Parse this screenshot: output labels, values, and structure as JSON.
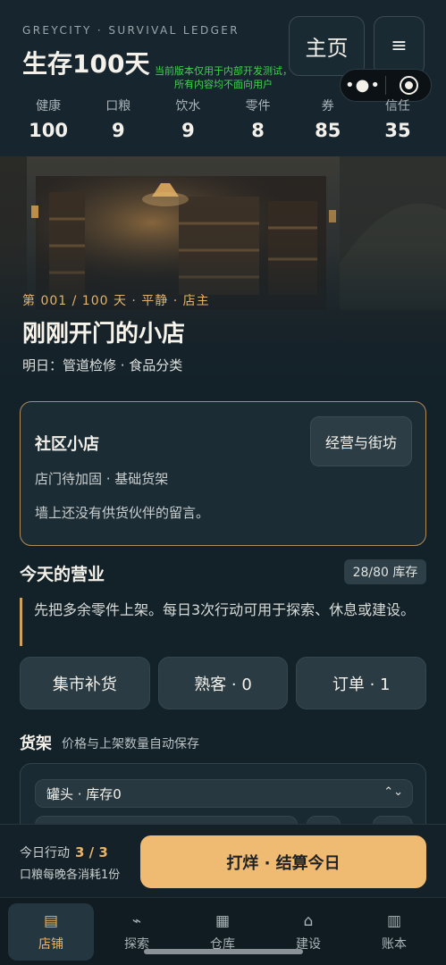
{
  "header": {
    "brand": "GREYCITY · SURVIVAL LEDGER",
    "title": "生存100天",
    "home_label": "主页",
    "menu_icon": "hamburger-menu-icon",
    "dev_notice_line1": "当前版本仅用于内部开发测试，",
    "dev_notice_line2": "所有内容均不面向用户",
    "capsule_more": "•●•",
    "stats": [
      {
        "label": "健康",
        "value": "100"
      },
      {
        "label": "口粮",
        "value": "9"
      },
      {
        "label": "饮水",
        "value": "9"
      },
      {
        "label": "零件",
        "value": "8"
      },
      {
        "label": "券",
        "value": "85"
      },
      {
        "label": "信任",
        "value": "35"
      }
    ]
  },
  "hero": {
    "meta": "第 001 / 100 天 · 平静 · 店主",
    "title": "刚刚开门的小店",
    "subtitle": "明日：管道检修 · 食品分类"
  },
  "shop": {
    "name": "社区小店",
    "status": "店门待加固 · 基础货架",
    "message": "墙上还没有供货伙伴的留言。",
    "link_label": "经营与街坊"
  },
  "business": {
    "title": "今天的营业",
    "stock_badge": "28/80 库存",
    "tip": "先把多余零件上架。每日3次行动可用于探索、休息或建设。",
    "actions": [
      "集市补货",
      "熟客 · 0",
      "订单 · 1"
    ]
  },
  "shelf": {
    "title": "货架",
    "subtitle": "价格与上架数量自动保存",
    "selected_item": "罐头 · 库存0",
    "caret": "⌃⌄"
  },
  "footer": {
    "actions_label": "今日行动",
    "actions_value": "3 / 3",
    "ration_note": "口粮每晚各消耗1份",
    "settle_label": "打烊 · 结算今日"
  },
  "tabs": [
    {
      "label": "店铺",
      "icon": "▤",
      "icon_name": "shop-icon"
    },
    {
      "label": "探索",
      "icon": "⌁",
      "icon_name": "explore-icon"
    },
    {
      "label": "仓库",
      "icon": "▦",
      "icon_name": "warehouse-icon"
    },
    {
      "label": "建设",
      "icon": "⌂",
      "icon_name": "build-icon"
    },
    {
      "label": "账本",
      "icon": "▥",
      "icon_name": "ledger-icon"
    }
  ],
  "colors": {
    "background": "#132129",
    "accent": "#e8b46a",
    "primary_button": "#efbb73",
    "dev_notice": "#3ed34f"
  }
}
